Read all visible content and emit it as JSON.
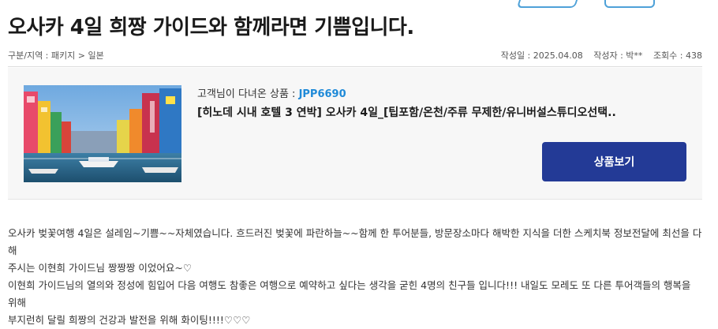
{
  "title": "오사카 4일 희짱 가이드와 함께라면 기쁨입니다.",
  "meta": {
    "category": "구분/지역 : 패키지 > 일본",
    "date": "작성일 : 2025.04.08",
    "author": "작성자 : 박**",
    "views": "조회수 : 438"
  },
  "product": {
    "label": "고객님이 다녀온 상품 :",
    "code": "JPP6690",
    "name": "[히노데 시내 호텔 3 연박] 오사카 4일_[팁포함/온천/주류 무제한/유니버설스튜디오선택..",
    "button": "상품보기",
    "image_icon": "dotonbori-canal-photo"
  },
  "content": {
    "lines": [
      "오사카 벚꽃여행 4일은 설레임~기쁨~~자체였습니다. 흐드러진 벚꽃에 파란하늘~~함께 한 투어분들, 방문장소마다 해박한 지식을 더한 스케치북 정보전달에 최선을 다해",
      "주시는 이현희 가이드님 짱짱짱 이었어요~♡",
      "이현희 가이드님의 열의와 정성에 힘입어 다음 여행도 참좋은 여행으로 예약하고 싶다는 생각을 굳힌 4명의 친구들 입니다!!! 내일도 모레도 또 다른 투어객들의 행복을 위해",
      "부지런히 달릴 희짱의 건강과 발전을 위해 화이팅!!!!♡♡♡"
    ]
  },
  "colors": {
    "accent": "#1f8ad8",
    "button": "#233a96",
    "box_bg": "#f7f7f7"
  }
}
